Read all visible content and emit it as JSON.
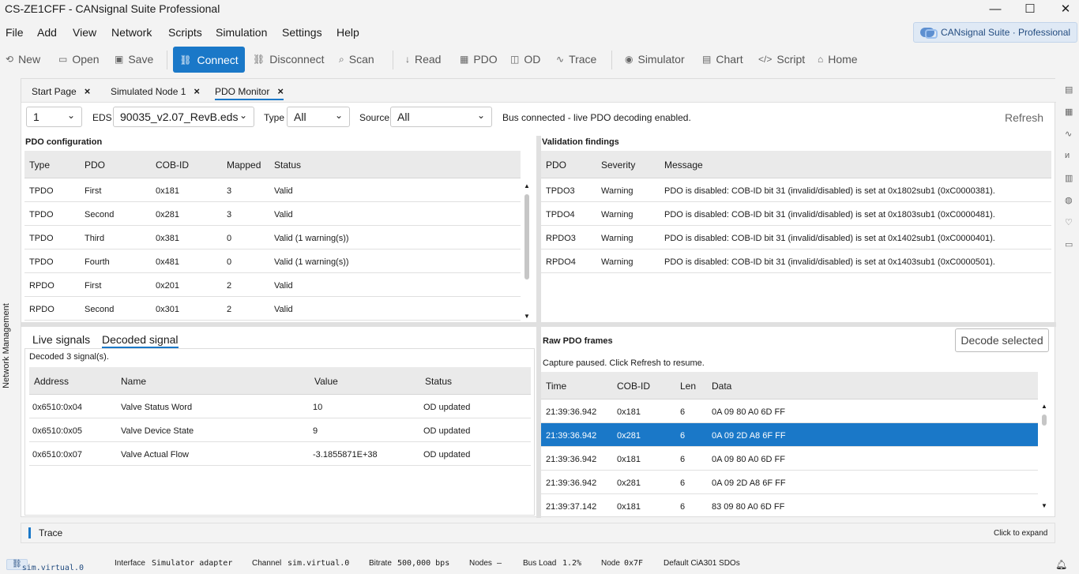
{
  "window": {
    "title": "CS-ZE1CFF - CANsignal Suite Professional",
    "minimize": "—",
    "maximize": "☐",
    "close": "✕"
  },
  "menu": [
    "File",
    "Add",
    "View",
    "Network",
    "Scripts",
    "Simulation",
    "Settings",
    "Help"
  ],
  "brand": "CANsignal Suite · Professional",
  "toolbar": {
    "new": "New",
    "open": "Open",
    "save": "Save",
    "connect": "Connect",
    "disconnect": "Disconnect",
    "scan": "Scan",
    "read": "Read",
    "pdo": "PDO",
    "od": "OD",
    "trace": "Trace",
    "simulator": "Simulator",
    "chart": "Chart",
    "script": "Script",
    "home": "Home"
  },
  "tabs": [
    {
      "label": "Start Page"
    },
    {
      "label": "Simulated Node 1"
    },
    {
      "label": "PDO Monitor"
    }
  ],
  "filters": {
    "node": "1",
    "eds_label": "EDS",
    "eds": "90035_v2.07_RevB.eds",
    "type_label": "Type",
    "type": "All",
    "source_label": "Source",
    "source": "All",
    "status": "Bus connected - live PDO decoding enabled.",
    "refresh": "Refresh"
  },
  "pdo_config": {
    "title": "PDO configuration",
    "columns": [
      "Type",
      "PDO",
      "COB-ID",
      "Mapped",
      "Status"
    ],
    "rows": [
      [
        "TPDO",
        "First",
        "0x181",
        "3",
        "Valid"
      ],
      [
        "TPDO",
        "Second",
        "0x281",
        "3",
        "Valid"
      ],
      [
        "TPDO",
        "Third",
        "0x381",
        "0",
        "Valid (1 warning(s))"
      ],
      [
        "TPDO",
        "Fourth",
        "0x481",
        "0",
        "Valid (1 warning(s))"
      ],
      [
        "RPDO",
        "First",
        "0x201",
        "2",
        "Valid"
      ],
      [
        "RPDO",
        "Second",
        "0x301",
        "2",
        "Valid"
      ]
    ]
  },
  "validation": {
    "title": "Validation findings",
    "columns": [
      "PDO",
      "Severity",
      "Message"
    ],
    "rows": [
      [
        "TPDO3",
        "Warning",
        "PDO is disabled: COB-ID bit 31 (invalid/disabled) is set at 0x1802sub1 (0xC0000381)."
      ],
      [
        "TPDO4",
        "Warning",
        "PDO is disabled: COB-ID bit 31 (invalid/disabled) is set at 0x1803sub1 (0xC0000481)."
      ],
      [
        "RPDO3",
        "Warning",
        "PDO is disabled: COB-ID bit 31 (invalid/disabled) is set at 0x1402sub1 (0xC0000401)."
      ],
      [
        "RPDO4",
        "Warning",
        "PDO is disabled: COB-ID bit 31 (invalid/disabled) is set at 0x1403sub1 (0xC0000501)."
      ]
    ]
  },
  "signals": {
    "tab_live": "Live signals",
    "tab_decoded": "Decoded signal",
    "summary": "Decoded 3 signal(s).",
    "columns": [
      "Address",
      "Name",
      "Value",
      "Status"
    ],
    "rows": [
      [
        "0x6510:0x04",
        "Valve Status Word",
        "10",
        "OD updated"
      ],
      [
        "0x6510:0x05",
        "Valve Device State",
        "9",
        "OD updated"
      ],
      [
        "0x6510:0x07",
        "Valve Actual Flow",
        "-3.1855871E+38",
        "OD updated"
      ]
    ]
  },
  "raw": {
    "title": "Raw PDO frames",
    "decode_button": "Decode selected",
    "status": "Capture paused. Click Refresh to resume.",
    "columns": [
      "Time",
      "COB-ID",
      "Len",
      "Data"
    ],
    "rows": [
      [
        "21:39:36.942",
        "0x181",
        "6",
        "0A 09 80 A0 6D FF"
      ],
      [
        "21:39:36.942",
        "0x281",
        "6",
        "0A 09 2D A8 6F FF"
      ],
      [
        "21:39:36.942",
        "0x181",
        "6",
        "0A 09 80 A0 6D FF"
      ],
      [
        "21:39:36.942",
        "0x281",
        "6",
        "0A 09 2D A8 6F FF"
      ],
      [
        "21:39:37.142",
        "0x181",
        "6",
        "83 09 80 A0 6D FF"
      ]
    ],
    "selected_row": 1
  },
  "trace": {
    "label": "Trace",
    "hint": "Click to expand"
  },
  "left_rail": "Network Management",
  "status": {
    "sim": "sim.virtual.0",
    "interface_label": "Interface",
    "interface": "Simulator adapter",
    "channel_label": "Channel",
    "channel": "sim.virtual.0",
    "bitrate_label": "Bitrate",
    "bitrate": "500,000 bps",
    "nodes_label": "Nodes",
    "nodes": "–",
    "busload_label": "Bus Load",
    "busload": "1.2%",
    "node_label": "Node",
    "node": "0x7F",
    "sdo": "Default CiA301 SDOs"
  }
}
